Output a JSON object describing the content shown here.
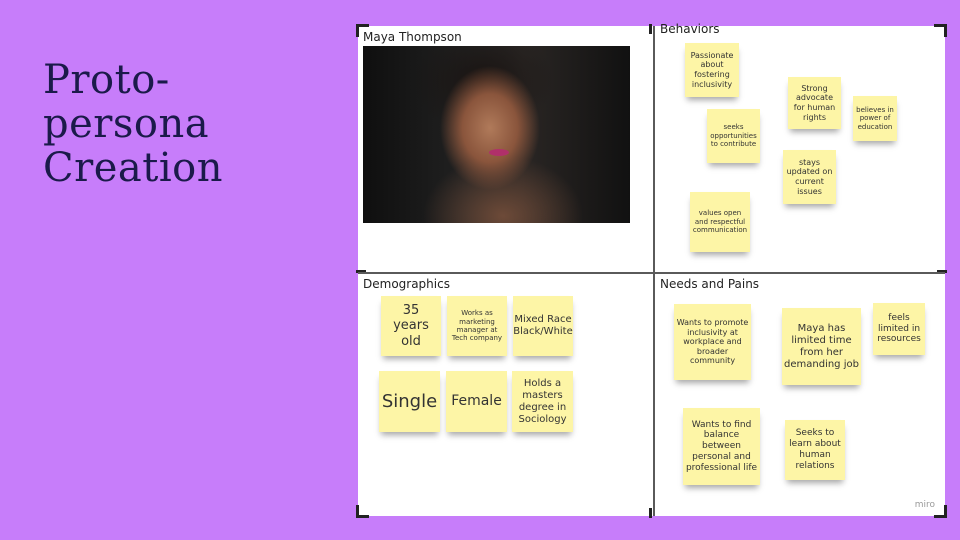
{
  "slide": {
    "title_lines": [
      "Proto-",
      "persona",
      "Creation"
    ]
  },
  "board": {
    "persona_name": "Maya Thompson",
    "sections": {
      "behaviors": "Behaviors",
      "demographics": "Demographics",
      "needs_pains": "Needs and Pains"
    },
    "behaviors_notes": [
      "Passionate about fostering inclusivity",
      "Strong advocate for human rights",
      "believes in power of education",
      "seeks opportunities to contribute",
      "stays updated on current issues",
      "values open and respectful communication"
    ],
    "demographics_notes": [
      "35 years old",
      "Works as marketing manager at Tech company",
      "Mixed Race Black/White",
      "Single",
      "Female",
      "Holds a masters degree in Sociology"
    ],
    "needs_notes": [
      "Wants to promote inclusivity at workplace and broader community",
      "Maya has limited time from her demanding job",
      "feels limited in resources",
      "Wants to find balance between personal and professional life",
      "Seeks to learn about human relations"
    ],
    "watermark": "miro"
  },
  "colors": {
    "background": "#c77dfa",
    "title": "#1b1a4a",
    "sticky_note": "#fdf5a6"
  }
}
